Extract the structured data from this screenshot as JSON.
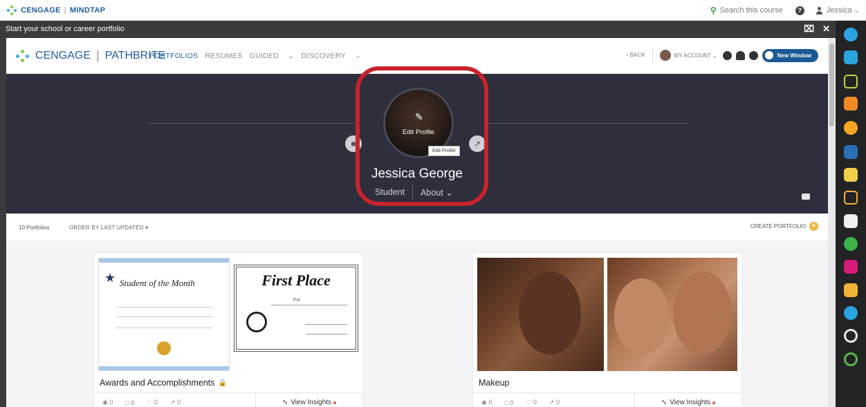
{
  "mindtap": {
    "brand": "CENGAGE",
    "product": "MINDTAP",
    "search_placeholder": "Search this course",
    "user": "Jessica"
  },
  "shell": {
    "title": "Start your school or career portfolio"
  },
  "pathbrite": {
    "brand": "CENGAGE",
    "product": "PATHBRITE",
    "nav": [
      "PORTFOLIOS",
      "RESUMES",
      "GUIDED",
      "DISCOVERY"
    ],
    "back": "BACK",
    "my_account": "MY ACCOUNT",
    "new_window": "New Window"
  },
  "profile": {
    "name": "Jessica George",
    "role": "Student",
    "about": "About",
    "edit_profile": "Edit Profile",
    "tooltip": "Edit Profile"
  },
  "portfolio_bar": {
    "count": "10 Portfolios",
    "order": "ORDER BY LAST UPDATED",
    "create": "CREATE PORTFOLIO"
  },
  "cards": [
    {
      "title": "Awards and Accomplishments",
      "locked": true,
      "views": "0",
      "comments": "0",
      "likes": "0",
      "shares": "0",
      "insights": "View Insights",
      "cert_left_title": "Student of the Month",
      "cert_right_title": "First Place",
      "cert_right_for": "For"
    },
    {
      "title": "Makeup",
      "locked": false,
      "views": "0",
      "comments": "0",
      "likes": "0",
      "shares": "0",
      "insights": "View Insights"
    }
  ],
  "colors": {
    "brand_blue": "#1f5fa0",
    "hero_bg": "#2e2e3c",
    "highlight_red": "#c8232c",
    "accent_orange": "#f3b33d",
    "shell_dark": "#3b3b3d"
  },
  "toolbar_icons": [
    "cengage-icon",
    "briefcase-icon",
    "pencil-icon",
    "rss-icon",
    "refresh-icon",
    "book-icon",
    "note-icon",
    "flow-icon",
    "chat-icon",
    "s-app-icon",
    "monitor-icon",
    "a-z-icon",
    "chart-icon",
    "q-icon",
    "o-app-icon"
  ]
}
